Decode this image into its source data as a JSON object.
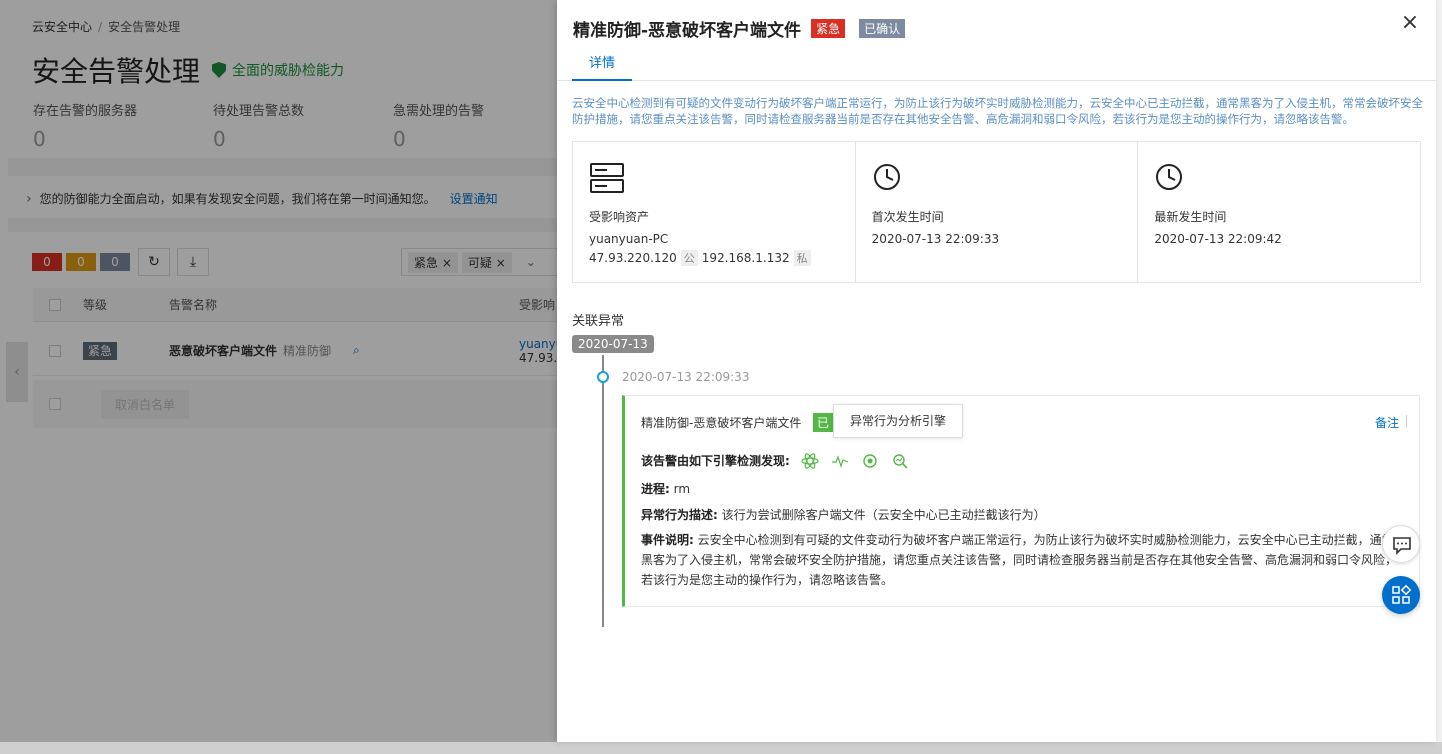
{
  "background": {
    "breadcrumb": [
      "云安全中心",
      "安全告警处理"
    ],
    "breadcrumb_sep": "/",
    "page_title": "安全告警处理",
    "capability": "全面的威胁检能力",
    "stats": [
      {
        "label": "存在告警的服务器",
        "value": "0"
      },
      {
        "label": "待处理告警总数",
        "value": "0"
      },
      {
        "label": "急需处理的告警",
        "value": "0"
      }
    ],
    "notice": "您的防御能力全面启动，如果有发现安全问题，我们将在第一时间通知您。",
    "notice_link": "设置通知",
    "counts": [
      {
        "value": "0",
        "color": "#d93026"
      },
      {
        "value": "0",
        "color": "#e09b16"
      },
      {
        "value": "0",
        "color": "#7d8aa0"
      }
    ],
    "filters": [
      "紧急",
      "可疑"
    ],
    "table": {
      "headers": [
        "等级",
        "告警名称",
        "受影响"
      ],
      "row": {
        "level": "紧急",
        "name": "恶意破坏客户端文件",
        "sub": "精准防御",
        "asset": "yuanyu",
        "ip": "47.93."
      },
      "footer_button": "取消白名单"
    }
  },
  "drawer": {
    "title": "精准防御-恶意破坏客户端文件",
    "badge_level": "紧急",
    "badge_status": "已确认",
    "close": "×",
    "tab": "详情",
    "description": "云安全中心检测到有可疑的文件变动行为破坏客户端正常运行，为防止该行为破坏实时威胁检测能力，云安全中心已主动拦截，通常黑客为了入侵主机，常常会破坏安全防护措施，请您重点关注该告警，同时请检查服务器当前是否存在其他安全告警、高危漏洞和弱口令风险，若该行为是您主动的操作行为，请忽略该告警。",
    "asset": {
      "label": "受影响资产",
      "name": "yuanyuan-PC",
      "public_ip": "47.93.220.120",
      "public_tag": "公",
      "private_ip": "192.168.1.132",
      "private_tag": "私"
    },
    "first_time": {
      "label": "首次发生时间",
      "value": "2020-07-13 22:09:33"
    },
    "last_time": {
      "label": "最新发生时间",
      "value": "2020-07-13 22:09:42"
    },
    "related_title": "关联异常",
    "date_pill": "2020-07-13",
    "event_time": "2020-07-13 22:09:33",
    "event": {
      "title": "精准防御-恶意破坏客户端文件",
      "tag": "已",
      "tooltip": "异常行为分析引擎",
      "note": "备注",
      "engine_label": "该告警由如下引擎检测发现:",
      "process_label": "进程:",
      "process_value": "rm",
      "behavior_label": "异常行为描述:",
      "behavior_value": "该行为尝试删除客户端文件（云安全中心已主动拦截该行为）",
      "explain_label": "事件说明:",
      "explain_value": "云安全中心检测到有可疑的文件变动行为破坏客户端正常运行，为防止该行为破坏实时威胁检测能力，云安全中心已主动拦截，通常黑客为了入侵主机，常常会破坏安全防护措施，请您重点关注该告警，同时请检查服务器当前是否存在其他安全告警、高危漏洞和弱口令风险，若该行为是您主动的操作行为，请忽略该告警。"
    }
  },
  "colors": {
    "accent": "#0070cc",
    "danger": "#d93026",
    "success": "#52b944"
  },
  "icons": {
    "server": "server-icon",
    "clock": "clock-icon",
    "chat": "chat-icon",
    "apps": "apps-icon"
  }
}
